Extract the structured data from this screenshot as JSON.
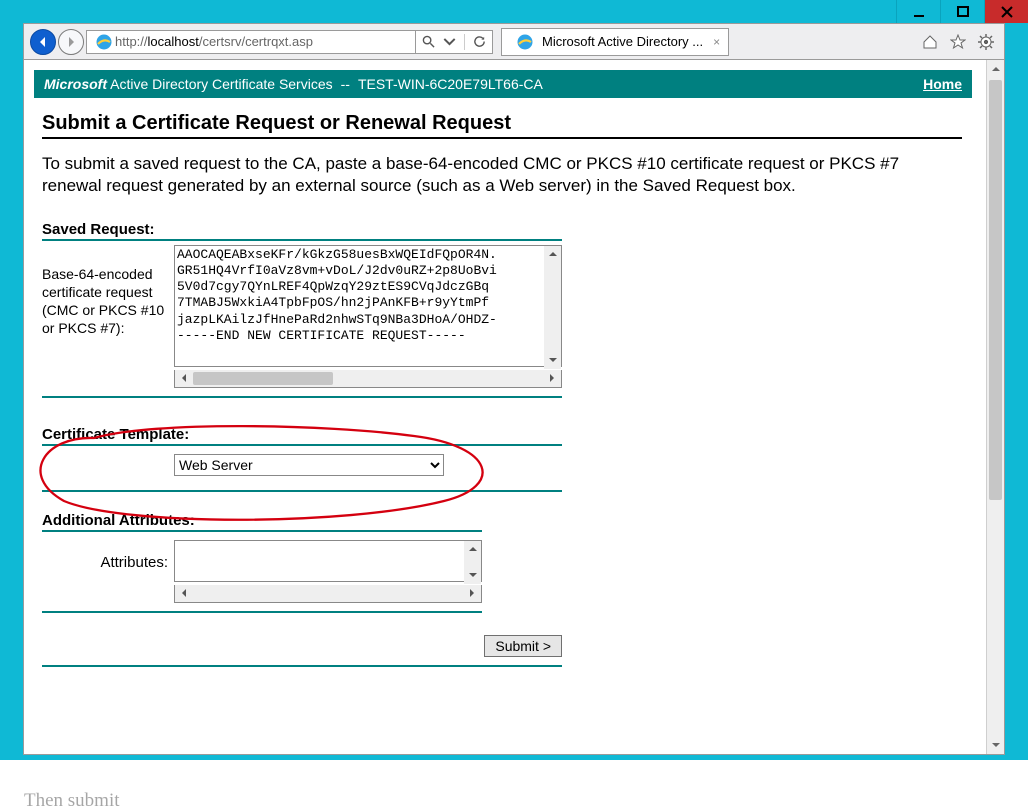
{
  "window": {
    "minimize": "−",
    "maximize": "□",
    "close": "×"
  },
  "browser": {
    "url_prefix": "http://",
    "url_host": "localhost",
    "url_path": "/certsrv/certrqxt.asp",
    "tab_title": "Microsoft Active Directory ...",
    "home_icon": "⌂",
    "star_icon": "★",
    "gear_icon": "⚙"
  },
  "banner": {
    "product_italic": "Microsoft",
    "product_rest": " Active Directory Certificate Services",
    "separator": "--",
    "ca_name": "TEST-WIN-6C20E79LT66-CA",
    "home": "Home"
  },
  "page": {
    "heading": "Submit a Certificate Request or Renewal Request",
    "intro": "To submit a saved request to the CA, paste a base-64-encoded CMC or PKCS #10 certificate request or PKCS #7 renewal request generated by an external source (such as a Web server) in the Saved Request box.",
    "saved_request_label": "Saved Request:",
    "saved_request_left": "Base-64-encoded certificate request (CMC or PKCS #10 or PKCS #7):",
    "saved_request_text": "AAOCAQEABxseKFr/kGkzG58uesBxWQEIdFQpOR4N.\nGR51HQ4VrfI0aVz8vm+vDoL/J2dv0uRZ+2p8UoBvi\n5V0d7cgy7QYnLREF4QpWzqY29ztES9CVqJdczGBq\n7TMABJ5WxkiA4TpbFpOS/hn2jPAnKFB+r9yYtmPf\njazpLKAilzJfHnePaRd2nhwSTq9NBa3DHoA/OHDZ-\n-----END NEW CERTIFICATE REQUEST-----",
    "cert_template_label": "Certificate Template:",
    "cert_template_value": "Web Server",
    "additional_attr_label": "Additional Attributes:",
    "attributes_label": "Attributes:",
    "attributes_value": "",
    "submit": "Submit >"
  },
  "below_text": "Then submit"
}
